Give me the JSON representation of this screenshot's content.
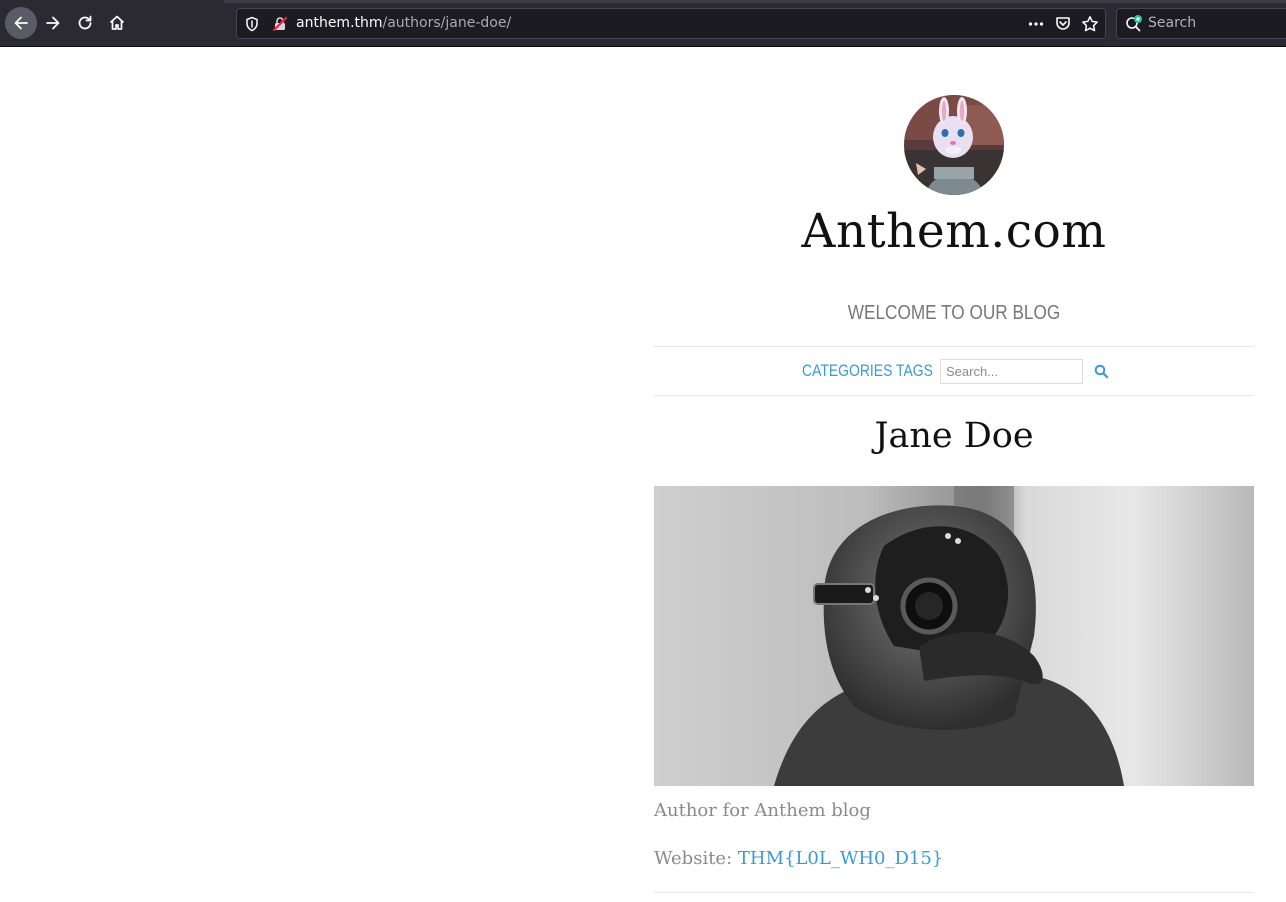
{
  "browser": {
    "url_host": "anthem.thm",
    "url_path": "/authors/jane-doe/",
    "search_placeholder": "Search",
    "icons": [
      "back-arrow-icon",
      "forward-arrow-icon",
      "reload-icon",
      "home-icon",
      "shield-icon",
      "insecure-lock-icon",
      "more-icon",
      "pocket-icon",
      "star-icon",
      "search-icon"
    ]
  },
  "site": {
    "title": "Anthem.com",
    "tagline": "WELCOME TO OUR BLOG",
    "avatar_alt": "avatar"
  },
  "nav": {
    "categories": "CATEGORIES",
    "tags": "TAGS",
    "search_placeholder": "Search...",
    "accent_color": "#3a9ad9"
  },
  "author": {
    "name": "Jane Doe",
    "bio": "Author for Anthem blog",
    "website_label": "Website: ",
    "website_value": "THM{L0L_WH0_D15}"
  }
}
